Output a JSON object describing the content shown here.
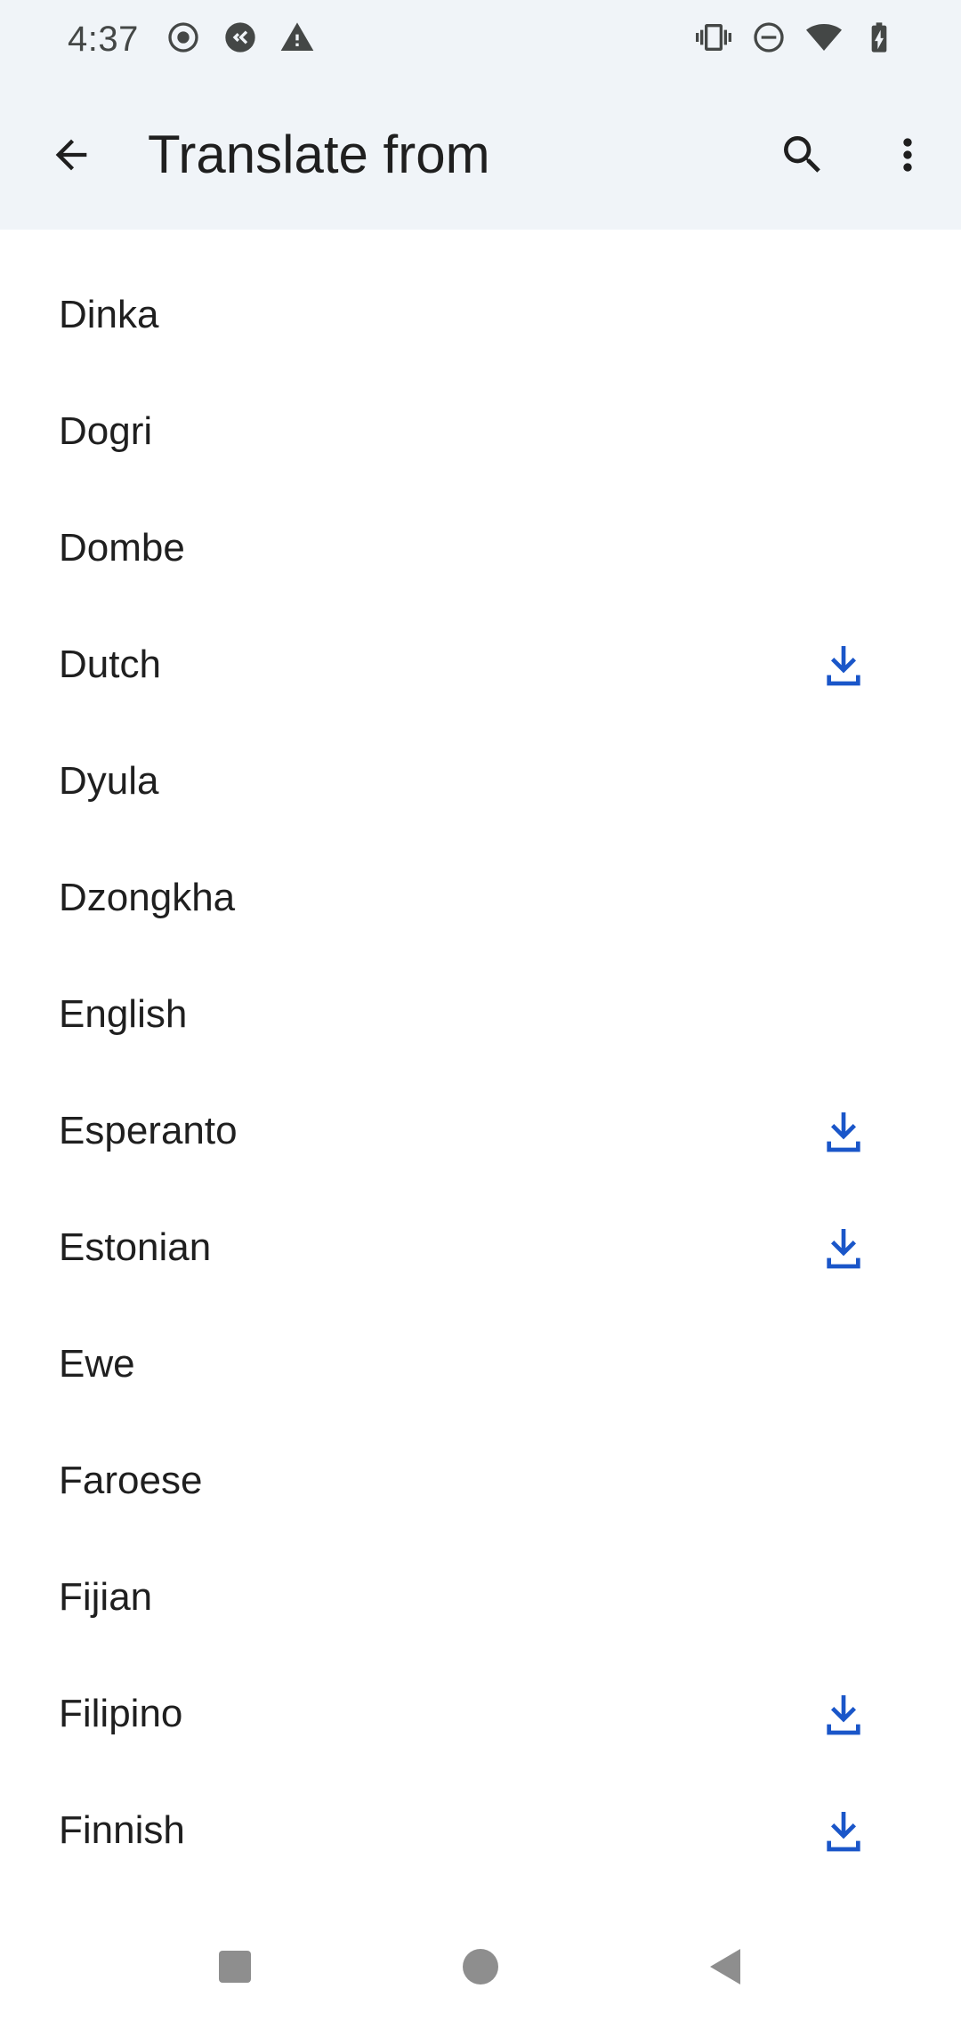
{
  "status_bar": {
    "time": "4:37",
    "left_icons": [
      "record-icon",
      "sync-app-icon",
      "warning-icon"
    ],
    "right_icons": [
      "vibrate-icon",
      "do-not-disturb-icon",
      "wifi-icon",
      "battery-charging-icon"
    ]
  },
  "app_bar": {
    "title": "Translate from",
    "back_icon": "arrow-back-icon",
    "search_icon": "search-icon",
    "more_icon": "more-vert-icon"
  },
  "languages": [
    {
      "label": "Dinka",
      "downloadable": false
    },
    {
      "label": "Dogri",
      "downloadable": false
    },
    {
      "label": "Dombe",
      "downloadable": false
    },
    {
      "label": "Dutch",
      "downloadable": true
    },
    {
      "label": "Dyula",
      "downloadable": false
    },
    {
      "label": "Dzongkha",
      "downloadable": false
    },
    {
      "label": "English",
      "downloadable": false
    },
    {
      "label": "Esperanto",
      "downloadable": true
    },
    {
      "label": "Estonian",
      "downloadable": true
    },
    {
      "label": "Ewe",
      "downloadable": false
    },
    {
      "label": "Faroese",
      "downloadable": false
    },
    {
      "label": "Fijian",
      "downloadable": false
    },
    {
      "label": "Filipino",
      "downloadable": true
    },
    {
      "label": "Finnish",
      "downloadable": true
    }
  ],
  "nav_bar": {
    "icons": [
      "recents-square-icon",
      "home-circle-icon",
      "back-triangle-icon"
    ]
  },
  "colors": {
    "accent": "#1a56c9",
    "header_bg": "#f0f4f8",
    "text": "#1f1f1f"
  }
}
